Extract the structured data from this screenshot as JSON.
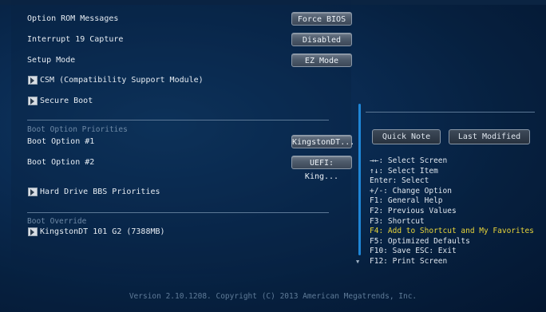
{
  "settings": [
    {
      "label": "Option ROM Messages",
      "value": "Force BIOS"
    },
    {
      "label": "Interrupt 19 Capture",
      "value": "Disabled"
    },
    {
      "label": "Setup Mode",
      "value": "EZ Mode"
    }
  ],
  "submenus": {
    "csm": "CSM (Compatibility Support Module)",
    "secure_boot": "Secure Boot",
    "hdd_bbs": "Hard Drive BBS Priorities",
    "override_device": "KingstonDT 101 G2  (7388MB)"
  },
  "boot_priorities": {
    "heading": "Boot Option Priorities",
    "options": [
      {
        "label": "Boot Option #1",
        "value": "KingstonDT..."
      },
      {
        "label": "Boot Option #2",
        "value": "UEFI: King..."
      }
    ]
  },
  "boot_override": {
    "heading": "Boot Override"
  },
  "right_panel": {
    "quick_note": "Quick Note",
    "last_modified": "Last Modified"
  },
  "help": {
    "select_screen": "→←: Select Screen",
    "select_item": "↑↓: Select Item",
    "enter": "Enter: Select",
    "change": "+/-: Change Option",
    "f1": "F1: General Help",
    "f2": "F2: Previous Values",
    "f3": "F3: Shortcut",
    "f4": "F4: Add to Shortcut and My Favorites",
    "f5": "F5: Optimized Defaults",
    "f10": "F10: Save  ESC: Exit",
    "f12": "F12: Print Screen"
  },
  "footer": "Version 2.10.1208. Copyright (C) 2013 American Megatrends, Inc.",
  "colors": {
    "highlight": "#e8d43a",
    "accent": "#1f86d6"
  }
}
